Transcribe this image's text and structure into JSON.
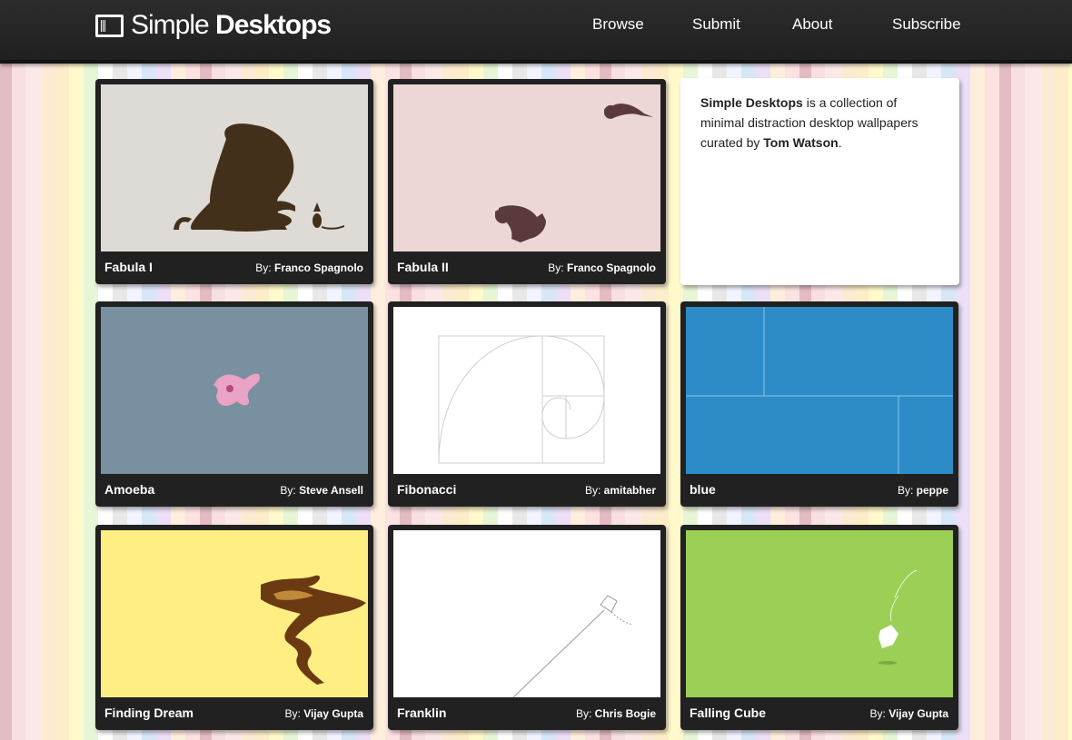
{
  "header": {
    "logo_icon": "desktop-monitor-icon",
    "logo_light": "Simple",
    "logo_bold": "Desktops",
    "nav": [
      {
        "label": "Browse"
      },
      {
        "label": "Submit"
      },
      {
        "label": "About"
      },
      {
        "label": "Subscribe"
      }
    ]
  },
  "about": {
    "brand": "Simple Desktops",
    "text": " is a collection of minimal distraction desktop wallpapers curated by ",
    "curator": "Tom Watson",
    "end": "."
  },
  "desktops": [
    {
      "title": "Fabula I",
      "by": "By:",
      "author": "Franco Spagnolo",
      "bg": "#dedad5"
    },
    {
      "title": "Fabula II",
      "by": "By:",
      "author": "Franco Spagnolo",
      "bg": "#ecd6d6"
    },
    {
      "title": "Amoeba",
      "by": "By:",
      "author": "Steve Ansell",
      "bg": "#7890a0"
    },
    {
      "title": "Fibonacci",
      "by": "By:",
      "author": "amitabher",
      "bg": "#ffffff"
    },
    {
      "title": "blue",
      "by": "By:",
      "author": "peppe",
      "bg": "#2d8cc7"
    },
    {
      "title": "Finding Dream",
      "by": "By:",
      "author": "Vijay Gupta",
      "bg": "#ffee82"
    },
    {
      "title": "Franklin",
      "by": "By:",
      "author": "Chris Bogie",
      "bg": "#ffffff"
    },
    {
      "title": "Falling Cube",
      "by": "By:",
      "author": "Vijay Gupta",
      "bg": "#9ccf55"
    }
  ]
}
